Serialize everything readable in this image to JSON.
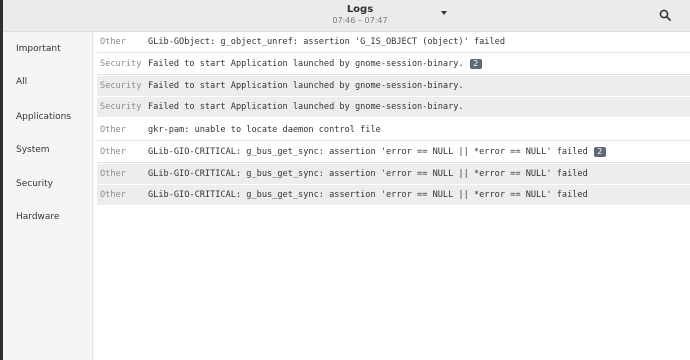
{
  "window": {
    "title": "Logs",
    "subtitle": "07:46 – 07:47"
  },
  "sidebar": {
    "items": [
      {
        "label": "Important"
      },
      {
        "label": "All"
      },
      {
        "label": "Applications"
      },
      {
        "label": "System"
      },
      {
        "label": "Security"
      },
      {
        "label": "Hardware"
      }
    ]
  },
  "logs": [
    {
      "category": "Other",
      "message": "GLib-GObject: g_object_unref: assertion 'G_IS_OBJECT (object)' failed",
      "count": ""
    },
    {
      "category": "Security",
      "message": "Failed to start Application launched by gnome-session-binary.",
      "count": "2"
    },
    {
      "category": "Security",
      "message": "Failed to start Application launched by gnome-session-binary.",
      "count": ""
    },
    {
      "category": "Security",
      "message": "Failed to start Application launched by gnome-session-binary.",
      "count": ""
    },
    {
      "category": "Other",
      "message": "gkr-pam: unable to locate daemon control file",
      "count": ""
    },
    {
      "category": "Other",
      "message": "GLib-GIO-CRITICAL: g_bus_get_sync: assertion 'error == NULL || *error == NULL' failed",
      "count": "2"
    },
    {
      "category": "Other",
      "message": "GLib-GIO-CRITICAL: g_bus_get_sync: assertion 'error == NULL || *error == NULL' failed",
      "count": ""
    },
    {
      "category": "Other",
      "message": "GLib-GIO-CRITICAL: g_bus_get_sync: assertion 'error == NULL || *error == NULL' failed",
      "count": ""
    }
  ],
  "icons": {
    "search": "search-icon",
    "dropdown": "chevron-down-icon"
  }
}
